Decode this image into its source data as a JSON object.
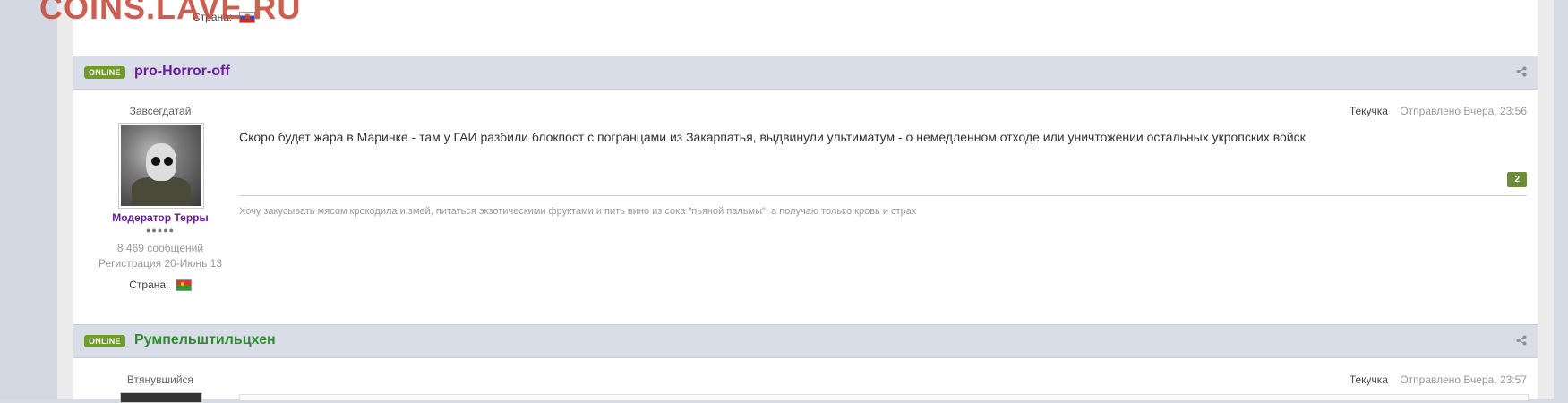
{
  "watermark": "COINS.LAVE.RU",
  "top_profile": {
    "country_label": "Страна:",
    "flag": "ru"
  },
  "posts": [
    {
      "status": "ONLINE",
      "author": "pro-Horror-off",
      "author_color": "#6a1b9a",
      "rank": "Завсегдатай",
      "group": "Модератор Терры",
      "pips": "●●●●●",
      "post_count": "8 469 сообщений",
      "registered": "Регистрация 20-Июнь 13",
      "country_label": "Страна:",
      "flag": "bf",
      "tag": "Текучка",
      "sent": "Отправлено Вчера, 23:56",
      "body": "Скоро будет жара в Маринке - там у ГАИ разбили блокпост с погранцами из Закарпатья, выдвинули ультиматум - о немедленном отходе или уничтожении остальных укропских войск",
      "reputation": "2",
      "signature": "Хочу закусывать мясом крокодила и змей, питаться экзотическими фруктами и пить вино из сока \"пьяной пальмы\", а получаю только кровь и страх"
    },
    {
      "status": "ONLINE",
      "author": "Румпельштильцхен",
      "author_color": "#2e8b2e",
      "rank": "Втянувшийся",
      "tag": "Текучка",
      "sent": "Отправлено Вчера, 23:57"
    }
  ]
}
